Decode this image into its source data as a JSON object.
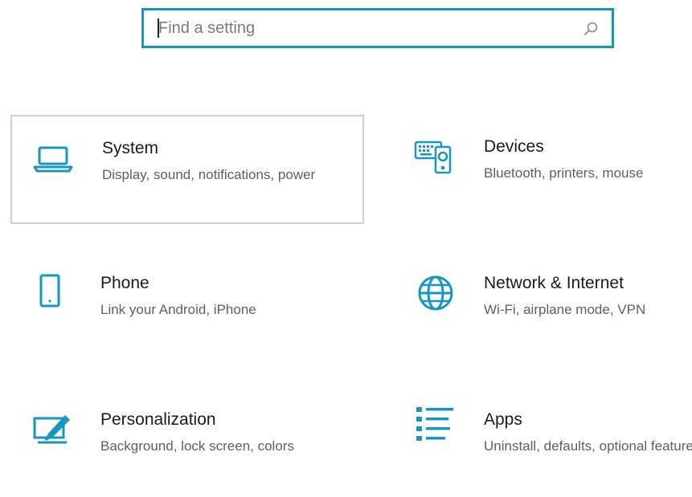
{
  "search": {
    "placeholder": "Find a setting"
  },
  "accent_color": "#1596c3",
  "tiles": [
    {
      "title": "System",
      "description": "Display, sound, notifications, power",
      "icon": "laptop-icon"
    },
    {
      "title": "Devices",
      "description": "Bluetooth, printers, mouse",
      "icon": "devices-icon"
    },
    {
      "title": "Phone",
      "description": "Link your Android, iPhone",
      "icon": "phone-icon"
    },
    {
      "title": "Network & Internet",
      "description": "Wi-Fi, airplane mode, VPN",
      "icon": "globe-icon"
    },
    {
      "title": "Personalization",
      "description": "Background, lock screen, colors",
      "icon": "paintbrush-icon"
    },
    {
      "title": "Apps",
      "description": "Uninstall, defaults, optional features",
      "icon": "apps-list-icon"
    }
  ]
}
